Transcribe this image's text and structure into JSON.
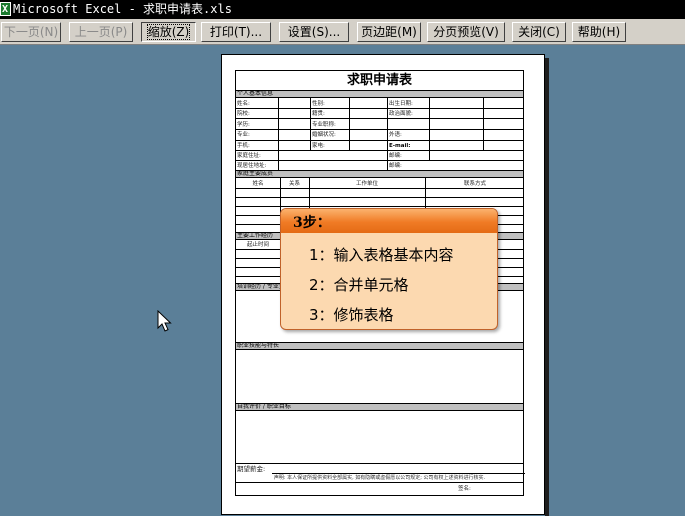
{
  "window": {
    "title": "Microsoft Excel - 求职申请表.xls"
  },
  "toolbar": {
    "buttons": [
      {
        "label": "下一页(N)",
        "state": "disabled"
      },
      {
        "label": "上一页(P)",
        "state": "disabled"
      },
      {
        "label": "缩放(Z)",
        "state": "pressed"
      },
      {
        "label": "打印(T)...",
        "state": "normal"
      },
      {
        "label": "设置(S)...",
        "state": "normal"
      },
      {
        "label": "页边距(M)",
        "state": "normal"
      },
      {
        "label": "分页预览(V)",
        "state": "normal"
      },
      {
        "label": "关闭(C)",
        "state": "normal"
      },
      {
        "label": "帮助(H)",
        "state": "normal"
      }
    ]
  },
  "form": {
    "title": "求职申请表",
    "sections": {
      "personal": "个人基本信息",
      "family": "家庭主要成员",
      "work": "主要工作经历",
      "training": "培训经历 / 专业资格",
      "skills": "职业技能与特长",
      "self_eval": "自我评价 / 职业目标"
    },
    "personal_fields": {
      "name": "姓名:",
      "gender": "性别:",
      "birth": "出生日期:",
      "school": "院校:",
      "height": "籍贯:",
      "blood": "政治面貌:",
      "education": "学历:",
      "major": "专业职称:",
      "specialty": "专业:",
      "marital": "婚姻状况:",
      "health": "外语:",
      "phone": "手机:",
      "home": "家电:",
      "email": "E-mail:",
      "address": "家庭住址:",
      "postcode1": "邮编:",
      "current_address": "现居住地址:",
      "postcode2": "邮编:"
    },
    "family_headers": [
      "姓名",
      "关系",
      "工作单位",
      "联系方式"
    ],
    "work_headers": [
      "起止时间"
    ],
    "expected_salary": "期望薪金:",
    "declaration": "声明: 本人保证所提供资料全部属实, 如有隐瞒或虚假愿以公司规定; 公司有权上述资料进行核实.",
    "signature": "签名:"
  },
  "callout": {
    "title": "3步：",
    "steps": [
      "1：输入表格基本内容",
      "2：合并单元格",
      "3：修饰表格"
    ],
    "colors": {
      "header": "#f07b25",
      "body": "#fcd9b0",
      "border": "#c0622a"
    }
  },
  "colors": {
    "background": "#5b7f98",
    "toolbar": "#d4d0c8",
    "section_fill": "#c0c0c0"
  }
}
